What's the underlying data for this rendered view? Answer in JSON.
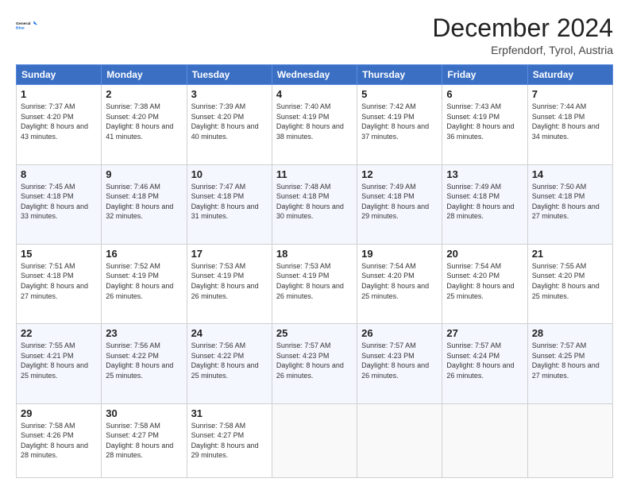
{
  "header": {
    "logo_line1": "General",
    "logo_line2": "Blue",
    "month_title": "December 2024",
    "location": "Erpfendorf, Tyrol, Austria"
  },
  "days_of_week": [
    "Sunday",
    "Monday",
    "Tuesday",
    "Wednesday",
    "Thursday",
    "Friday",
    "Saturday"
  ],
  "weeks": [
    [
      {
        "day": "1",
        "sunrise": "7:37 AM",
        "sunset": "4:20 PM",
        "daylight": "8 hours and 43 minutes."
      },
      {
        "day": "2",
        "sunrise": "7:38 AM",
        "sunset": "4:20 PM",
        "daylight": "8 hours and 41 minutes."
      },
      {
        "day": "3",
        "sunrise": "7:39 AM",
        "sunset": "4:20 PM",
        "daylight": "8 hours and 40 minutes."
      },
      {
        "day": "4",
        "sunrise": "7:40 AM",
        "sunset": "4:19 PM",
        "daylight": "8 hours and 38 minutes."
      },
      {
        "day": "5",
        "sunrise": "7:42 AM",
        "sunset": "4:19 PM",
        "daylight": "8 hours and 37 minutes."
      },
      {
        "day": "6",
        "sunrise": "7:43 AM",
        "sunset": "4:19 PM",
        "daylight": "8 hours and 36 minutes."
      },
      {
        "day": "7",
        "sunrise": "7:44 AM",
        "sunset": "4:18 PM",
        "daylight": "8 hours and 34 minutes."
      }
    ],
    [
      {
        "day": "8",
        "sunrise": "7:45 AM",
        "sunset": "4:18 PM",
        "daylight": "8 hours and 33 minutes."
      },
      {
        "day": "9",
        "sunrise": "7:46 AM",
        "sunset": "4:18 PM",
        "daylight": "8 hours and 32 minutes."
      },
      {
        "day": "10",
        "sunrise": "7:47 AM",
        "sunset": "4:18 PM",
        "daylight": "8 hours and 31 minutes."
      },
      {
        "day": "11",
        "sunrise": "7:48 AM",
        "sunset": "4:18 PM",
        "daylight": "8 hours and 30 minutes."
      },
      {
        "day": "12",
        "sunrise": "7:49 AM",
        "sunset": "4:18 PM",
        "daylight": "8 hours and 29 minutes."
      },
      {
        "day": "13",
        "sunrise": "7:49 AM",
        "sunset": "4:18 PM",
        "daylight": "8 hours and 28 minutes."
      },
      {
        "day": "14",
        "sunrise": "7:50 AM",
        "sunset": "4:18 PM",
        "daylight": "8 hours and 27 minutes."
      }
    ],
    [
      {
        "day": "15",
        "sunrise": "7:51 AM",
        "sunset": "4:18 PM",
        "daylight": "8 hours and 27 minutes."
      },
      {
        "day": "16",
        "sunrise": "7:52 AM",
        "sunset": "4:19 PM",
        "daylight": "8 hours and 26 minutes."
      },
      {
        "day": "17",
        "sunrise": "7:53 AM",
        "sunset": "4:19 PM",
        "daylight": "8 hours and 26 minutes."
      },
      {
        "day": "18",
        "sunrise": "7:53 AM",
        "sunset": "4:19 PM",
        "daylight": "8 hours and 26 minutes."
      },
      {
        "day": "19",
        "sunrise": "7:54 AM",
        "sunset": "4:20 PM",
        "daylight": "8 hours and 25 minutes."
      },
      {
        "day": "20",
        "sunrise": "7:54 AM",
        "sunset": "4:20 PM",
        "daylight": "8 hours and 25 minutes."
      },
      {
        "day": "21",
        "sunrise": "7:55 AM",
        "sunset": "4:20 PM",
        "daylight": "8 hours and 25 minutes."
      }
    ],
    [
      {
        "day": "22",
        "sunrise": "7:55 AM",
        "sunset": "4:21 PM",
        "daylight": "8 hours and 25 minutes."
      },
      {
        "day": "23",
        "sunrise": "7:56 AM",
        "sunset": "4:22 PM",
        "daylight": "8 hours and 25 minutes."
      },
      {
        "day": "24",
        "sunrise": "7:56 AM",
        "sunset": "4:22 PM",
        "daylight": "8 hours and 25 minutes."
      },
      {
        "day": "25",
        "sunrise": "7:57 AM",
        "sunset": "4:23 PM",
        "daylight": "8 hours and 26 minutes."
      },
      {
        "day": "26",
        "sunrise": "7:57 AM",
        "sunset": "4:23 PM",
        "daylight": "8 hours and 26 minutes."
      },
      {
        "day": "27",
        "sunrise": "7:57 AM",
        "sunset": "4:24 PM",
        "daylight": "8 hours and 26 minutes."
      },
      {
        "day": "28",
        "sunrise": "7:57 AM",
        "sunset": "4:25 PM",
        "daylight": "8 hours and 27 minutes."
      }
    ],
    [
      {
        "day": "29",
        "sunrise": "7:58 AM",
        "sunset": "4:26 PM",
        "daylight": "8 hours and 28 minutes."
      },
      {
        "day": "30",
        "sunrise": "7:58 AM",
        "sunset": "4:27 PM",
        "daylight": "8 hours and 28 minutes."
      },
      {
        "day": "31",
        "sunrise": "7:58 AM",
        "sunset": "4:27 PM",
        "daylight": "8 hours and 29 minutes."
      },
      null,
      null,
      null,
      null
    ]
  ],
  "labels": {
    "sunrise": "Sunrise:",
    "sunset": "Sunset:",
    "daylight": "Daylight:"
  }
}
